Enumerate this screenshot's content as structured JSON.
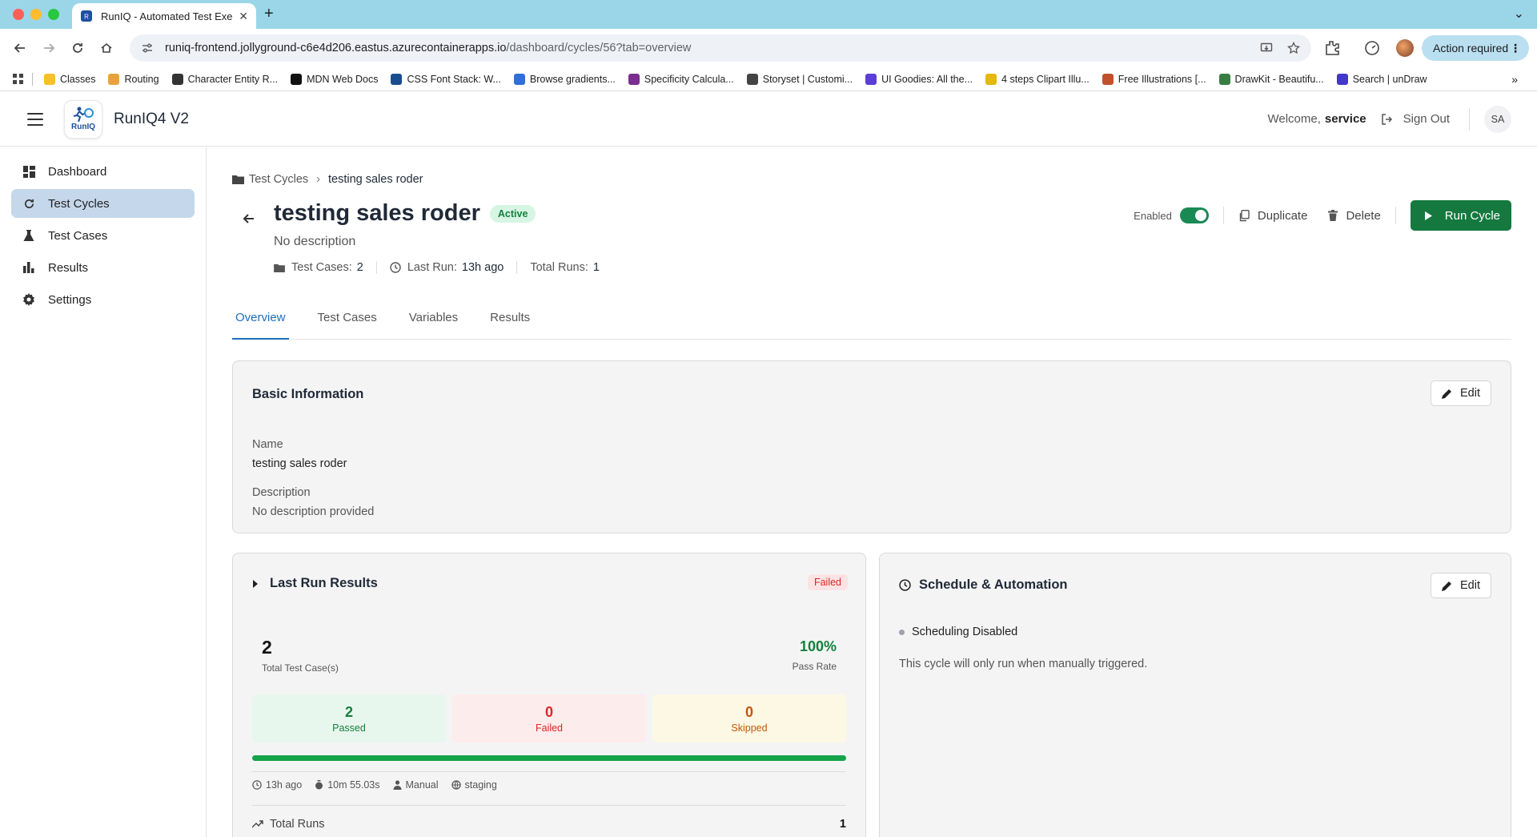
{
  "browser": {
    "tab_title": "RunIQ - Automated Test Exec",
    "url_host": "runiq-frontend.jollyground-c6e4d206.eastus.azurecontainerapps.io",
    "url_path": "/dashboard/cycles/56?tab=overview",
    "action_required": "Action required",
    "bookmarks": [
      {
        "label": "Classes",
        "color": "#f6c026"
      },
      {
        "label": "Routing",
        "color": "#e9a23b"
      },
      {
        "label": "Character Entity R...",
        "color": "#333333"
      },
      {
        "label": "MDN Web Docs",
        "color": "#111111"
      },
      {
        "label": "CSS Font Stack: W...",
        "color": "#1a4d8f"
      },
      {
        "label": "Browse gradients...",
        "color": "#2f6fd6"
      },
      {
        "label": "Specificity Calcula...",
        "color": "#7a2e8f"
      },
      {
        "label": "Storyset | Customi...",
        "color": "#444444"
      },
      {
        "label": "UI Goodies: All the...",
        "color": "#5b3fd6"
      },
      {
        "label": "4 steps Clipart Illu...",
        "color": "#e5b80b"
      },
      {
        "label": "Free Illustrations [...",
        "color": "#c2502c"
      },
      {
        "label": "DrawKit - Beautifu...",
        "color": "#3a7d44"
      },
      {
        "label": "Search | unDraw",
        "color": "#4338ca"
      }
    ]
  },
  "app": {
    "name": "RunIQ4 V2",
    "logo_text": "RunIQ",
    "welcome": "Welcome,",
    "user": "service",
    "sign_out": "Sign Out",
    "avatar_initials": "SA"
  },
  "sidebar": {
    "items": [
      {
        "label": "Dashboard",
        "icon": "dashboard-icon"
      },
      {
        "label": "Test Cycles",
        "icon": "refresh-icon",
        "active": true
      },
      {
        "label": "Test Cases",
        "icon": "flask-icon"
      },
      {
        "label": "Results",
        "icon": "bar-chart-icon"
      },
      {
        "label": "Settings",
        "icon": "gear-icon"
      }
    ]
  },
  "page": {
    "breadcrumb_parent": "Test Cycles",
    "breadcrumb_current": "testing sales roder",
    "title": "testing sales roder",
    "status": "Active",
    "description": "No description",
    "meta": {
      "test_cases_label": "Test Cases:",
      "test_cases_value": "2",
      "last_run_label": "Last Run:",
      "last_run_value": "13h ago",
      "total_runs_label": "Total Runs:",
      "total_runs_value": "1"
    },
    "actions": {
      "enabled_label": "Enabled",
      "enabled": true,
      "duplicate": "Duplicate",
      "delete": "Delete",
      "run_cycle": "Run Cycle"
    },
    "tabs": [
      "Overview",
      "Test Cases",
      "Variables",
      "Results"
    ],
    "active_tab": "Overview"
  },
  "basic_info": {
    "title": "Basic Information",
    "edit": "Edit",
    "name_label": "Name",
    "name_value": "testing sales roder",
    "description_label": "Description",
    "description_value": "No description provided"
  },
  "last_run": {
    "title": "Last Run Results",
    "status": "Failed",
    "total": "2",
    "total_label": "Total Test Case(s)",
    "pass_rate": "100%",
    "pass_rate_label": "Pass Rate",
    "pass_fraction": 1.0,
    "passed": "2",
    "passed_label": "Passed",
    "failed": "0",
    "failed_label": "Failed",
    "skipped": "0",
    "skipped_label": "Skipped",
    "time_ago": "13h ago",
    "duration": "10m 55.03s",
    "trigger": "Manual",
    "environment": "staging",
    "total_runs_label": "Total Runs",
    "total_runs": "1"
  },
  "schedule": {
    "title": "Schedule & Automation",
    "edit": "Edit",
    "status": "Scheduling Disabled",
    "note": "This cycle will only run when manually triggered."
  },
  "colors": {
    "primary": "#15793f",
    "accent_blue": "#1e6fbf",
    "active_nav": "#c5d7ea"
  }
}
